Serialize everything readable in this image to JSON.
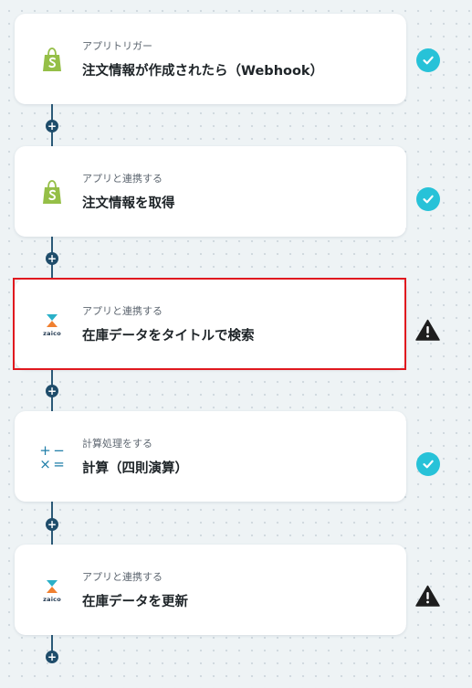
{
  "workflow": {
    "steps": [
      {
        "category": "アプリトリガー",
        "title": "注文情報が作成されたら（Webhook）",
        "app_icon": "shopify-icon",
        "status": "complete",
        "selected": false
      },
      {
        "category": "アプリと連携する",
        "title": "注文情報を取得",
        "app_icon": "shopify-icon",
        "status": "complete",
        "selected": false
      },
      {
        "category": "アプリと連携する",
        "title": "在庫データをタイトルで検索",
        "app_icon": "zaico-icon",
        "app_icon_text": "zaico",
        "status": "warning",
        "selected": true
      },
      {
        "category": "計算処理をする",
        "title": "計算（四則演算）",
        "app_icon": "calculator-icon",
        "status": "complete",
        "selected": false
      },
      {
        "category": "アプリと連携する",
        "title": "在庫データを更新",
        "app_icon": "zaico-icon",
        "app_icon_text": "zaico",
        "status": "warning",
        "selected": false
      }
    ],
    "add_step_symbol": "+",
    "calc_symbols": [
      "+",
      "−",
      "×",
      "="
    ]
  },
  "colors": {
    "background": "#eef3f5",
    "connector": "#2b5a78",
    "complete_badge": "#27c2d8",
    "warning_icon": "#1e1e1e",
    "selection_border": "#e0191f",
    "shopify_green": "#95bf47",
    "calc_blue": "#1f7ea8"
  }
}
